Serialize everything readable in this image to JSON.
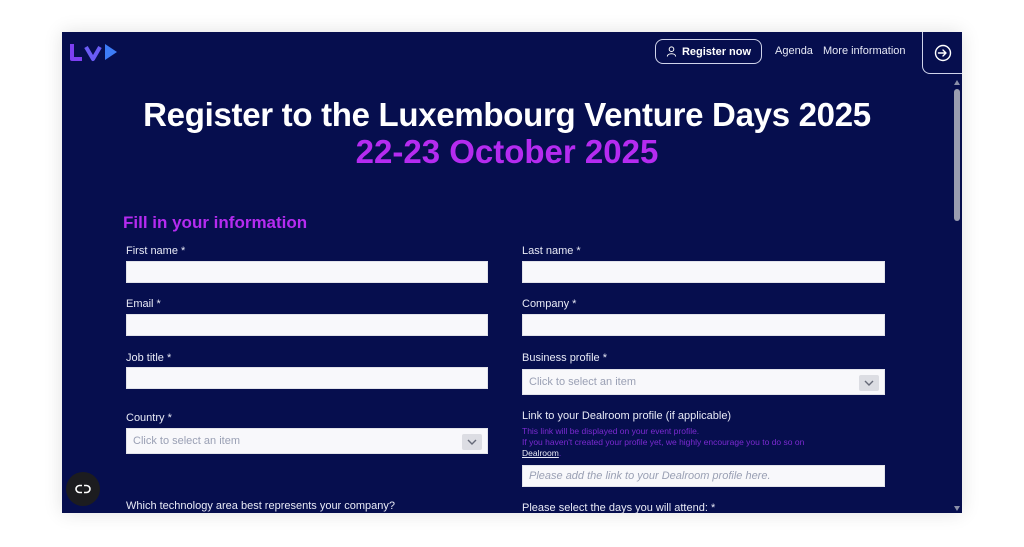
{
  "header": {
    "logo": "LVD",
    "register_label": "Register now",
    "nav": [
      "Agenda",
      "More information"
    ]
  },
  "hero": {
    "title": "Register to the Luxembourg Venture Days 2025",
    "date": "22-23 October 2025"
  },
  "form": {
    "heading": "Fill in your information",
    "first_name": "First name *",
    "last_name": "Last name *",
    "email": "Email *",
    "company": "Company *",
    "job_title": "Job title *",
    "business_profile": "Business profile *",
    "business_profile_placeholder": "Click to select an item",
    "country": "Country *",
    "country_placeholder": "Click to select an item",
    "dealroom_label": "Link to your Dealroom profile (if applicable)",
    "dealroom_hint_1": "This link will be displayed on your event profile.",
    "dealroom_hint_2": "If you haven't created your profile yet, we highly encourage you to do so on",
    "dealroom_hint_link": "Dealroom",
    "dealroom_hint_end": ".",
    "dealroom_placeholder": "Please add the link to your Dealroom profile here.",
    "technology_question": "Which technology area best represents your company?",
    "days_question": "Please select the days you will attend: *"
  },
  "colors": {
    "background": "#060e4e",
    "accent": "#b52bf0",
    "text": "#ffffff"
  }
}
